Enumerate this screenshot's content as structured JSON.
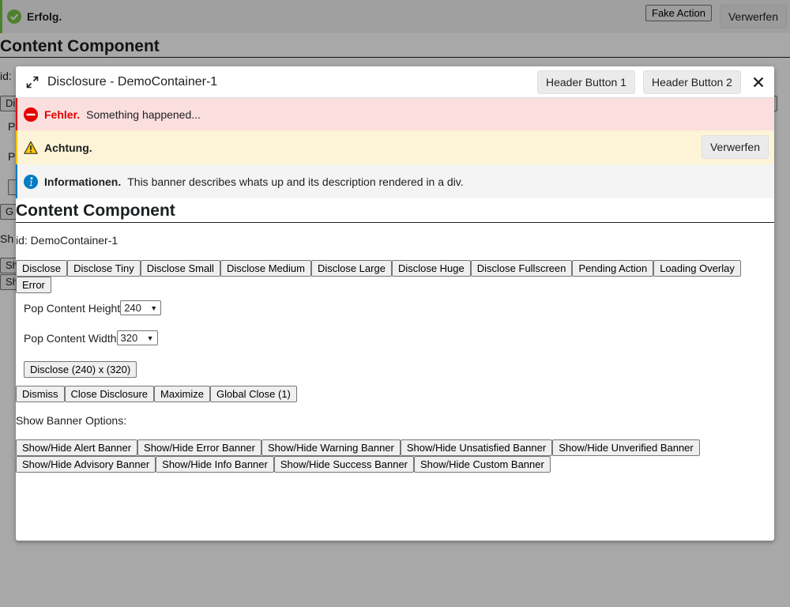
{
  "background": {
    "success_banner": {
      "title": "Erfolg.",
      "fake_action": "Fake Action",
      "dismiss": "Verwerfen"
    },
    "title": "Content Component",
    "fragments": {
      "id_prefix": "id:",
      "btn_a": "Di",
      "p1": "P",
      "p2": "P",
      "btn_b": "G",
      "show_prefix": "Sh",
      "btn_c": "Sh",
      "btn_d": "Sh"
    }
  },
  "modal": {
    "header": {
      "title": "Disclosure - DemoContainer-1",
      "button_1": "Header Button 1",
      "button_2": "Header Button 2"
    },
    "banners": {
      "error": {
        "title": "Fehler.",
        "description": "Something happened..."
      },
      "warning": {
        "title": "Achtung.",
        "dismiss": "Verwerfen"
      },
      "info": {
        "title": "Informationen.",
        "description": "This banner describes whats up and its description rendered in a div."
      }
    },
    "content": {
      "title": "Content Component",
      "id_text": "id: DemoContainer-1",
      "disclose_buttons": [
        "Disclose",
        "Disclose Tiny",
        "Disclose Small",
        "Disclose Medium",
        "Disclose Large",
        "Disclose Huge",
        "Disclose Fullscreen",
        "Pending Action",
        "Loading Overlay",
        "Error"
      ],
      "height_label": "Pop Content Height",
      "height_value": "240",
      "width_label": "Pop Content Width",
      "width_value": "320",
      "disclose_custom": "Disclose (240) x (320)",
      "action_buttons": [
        "Dismiss",
        "Close Disclosure",
        "Maximize",
        "Global Close (1)"
      ],
      "banner_options_label": "Show Banner Options:",
      "banner_buttons": [
        "Show/Hide Alert Banner",
        "Show/Hide Error Banner",
        "Show/Hide Warning Banner",
        "Show/Hide Unsatisfied Banner",
        "Show/Hide Unverified Banner",
        "Show/Hide Advisory Banner",
        "Show/Hide Info Banner",
        "Show/Hide Success Banner",
        "Show/Hide Custom Banner"
      ]
    }
  },
  "colors": {
    "success": "#78c346",
    "error": "#e50000",
    "warning": "#ffc20a",
    "info": "#007cc3"
  },
  "icons": {
    "success": "check-circle-icon",
    "maximize": "expand-icon",
    "close": "close-icon",
    "error": "minus-circle-icon",
    "warning": "warning-triangle-icon",
    "info": "info-circle-icon"
  }
}
